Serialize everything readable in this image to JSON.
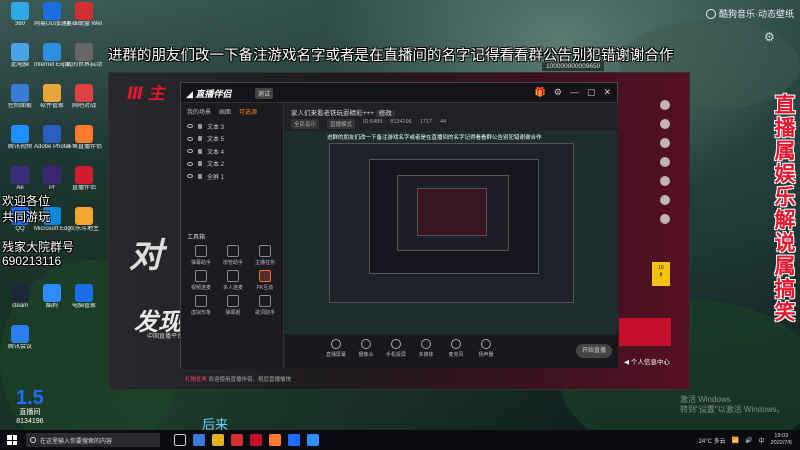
{
  "banner_text": "进群的朋友们改一下备注游戏名字或者是在直播间的名字记得看看群公告别犯错谢谢合作",
  "right_vertical_text": "直播属娱乐解说属搞笑",
  "left_overlay": [
    "欢迎各位",
    "共同游玩",
    "残家大院群号",
    "690213116"
  ],
  "top_right_logo": "酷狗音乐·动态壁纸",
  "desktop_icons": [
    {
      "label": "360",
      "color": "#2fa8e6"
    },
    {
      "label": "网易UU加速器",
      "color": "#1b6fe0"
    },
    {
      "label": "英雄联盟 WeGame",
      "color": "#d23030"
    },
    {
      "label": "此电脑",
      "color": "#4aa3e8"
    },
    {
      "label": "Internet Explorer",
      "color": "#2e8fe0"
    },
    {
      "label": "我的世界启动器",
      "color": "#666"
    },
    {
      "label": "控制面板",
      "color": "#3a7bd5"
    },
    {
      "label": "软件管家",
      "color": "#e9a43b"
    },
    {
      "label": "网吧对战",
      "color": "#e04040"
    },
    {
      "label": "腾讯视频",
      "color": "#1e90ff"
    },
    {
      "label": "Adobe Photoshop",
      "color": "#2a5fbf"
    },
    {
      "label": "斗鱼直播伴侣",
      "color": "#ff7a2a"
    },
    {
      "label": "Ae",
      "color": "#3a2f7a"
    },
    {
      "label": "Pr",
      "color": "#3a2570"
    },
    {
      "label": "直播伴侣",
      "color": "#d01c30"
    },
    {
      "label": "QQ",
      "color": "#1c6cff"
    },
    {
      "label": "Microsoft Edge",
      "color": "#0c8ad8"
    },
    {
      "label": "欢乐斗地主",
      "color": "#f2a62b"
    },
    {
      "label": "steam",
      "color": "#1b2838"
    },
    {
      "label": "酷狗",
      "color": "#2d8cff"
    },
    {
      "label": "电脑管家",
      "color": "#1a6ee8"
    },
    {
      "label": "腾讯会议",
      "color": "#2c7ff0"
    }
  ],
  "id_tag": "100000000009650",
  "app": {
    "promo_title": "发现剧",
    "promo_sub": "中国直播平台",
    "personal_center": "个人信息中心",
    "big_glyph": "对"
  },
  "companion": {
    "logo": "直播伴侣",
    "version": "测试",
    "tabs": [
      "我的场景",
      "画面",
      "可选源"
    ],
    "layers": [
      "文本 3",
      "文本 5",
      "文本 4",
      "文本 2",
      "全屏 1"
    ],
    "toolbox_title": "工具箱",
    "tools": [
      "弹幕助手",
      "房管助手",
      "主播任务",
      "视频连麦",
      "多人连麦",
      "PK互动",
      "虚拟形象",
      "弹幕姬",
      "歌词助手",
      "礼物特效",
      "投票",
      "更多"
    ],
    "bottom_msg_tag": "礼物任务",
    "bottom_msg": "欢迎使用直播伴侣，祝您直播愉快",
    "room_title": "家人们来看老铁玩耍精彩+++",
    "room_badge": "修改",
    "room_meta": [
      "全民音乐",
      "直播模式",
      "ID 6489",
      "8134196",
      "1717",
      "44"
    ],
    "bottom_bar": [
      "直播屏幕",
      "摄像头",
      "手机投屏",
      "多媒体",
      "麦克风",
      "扬声器"
    ],
    "start_btn": "开始直播",
    "preview_text": "进群的朋友们改一下备注游戏名字或者是在直播间的名字记得看看群公告别犯错谢谢合作"
  },
  "desk_watermark": [
    "激活 Windows",
    "转到\"设置\"以激活 Windows。"
  ],
  "houlai": "后来",
  "qq_badge": {
    "big": "1.5",
    "label": "直播间",
    "id": "8134196"
  },
  "taskbar": {
    "search_placeholder": "在这里输入你要搜索的内容",
    "weather": "24°C 多云",
    "time": "19:03",
    "date": "2022/7/6",
    "input_lang": "中"
  }
}
